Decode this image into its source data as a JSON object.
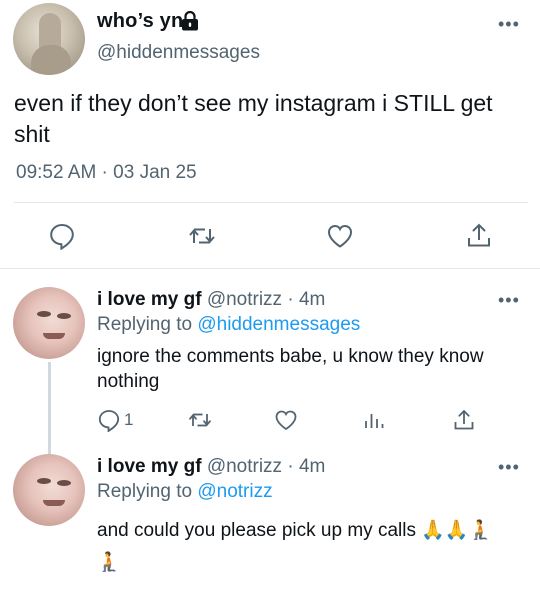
{
  "main_tweet": {
    "author_name": "who’s yn",
    "handle": "@hiddenmessages",
    "text": "even if they don’t see my instagram i STILL get shit",
    "timestamp": "09:52 AM · 03 Jan 25",
    "more": "•••",
    "icons": [
      "reply-icon",
      "retweet-icon",
      "like-icon",
      "share-icon"
    ]
  },
  "replies": [
    {
      "author_name": "i love my gf",
      "handle_time": "@notrizz · 4m",
      "replying_prefix": "Replying to ",
      "replying_to": "@hiddenmessages",
      "text": "ignore the comments babe, u know they know nothing",
      "more": "•••",
      "reply_count": "1"
    },
    {
      "author_name": "i love my gf",
      "handle_time": "@notrizz · 4m",
      "replying_prefix": "Replying to ",
      "replying_to": "@notrizz",
      "text": "and could you please pick up my calls 🙏🙏🧎",
      "text_wrap": "🧎",
      "more": "•••"
    }
  ],
  "colors": {
    "text": "#0f1419",
    "secondary": "#536471",
    "link": "#1d9bf0",
    "divider": "#e4e7ea"
  }
}
